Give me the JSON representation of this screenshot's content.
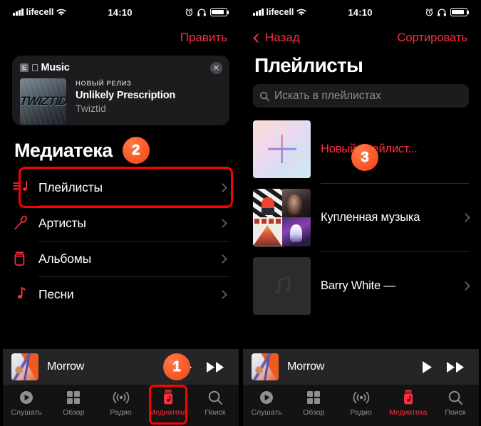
{
  "status_bar": {
    "carrier": "lifecell",
    "time": "14:10",
    "wifi_icon": "wifi-icon",
    "alarm_icon": "alarm-icon",
    "headphones_icon": "headphones-icon",
    "battery_icon": "battery-icon"
  },
  "colors": {
    "accent_red": "#ff2d3f",
    "highlight_red": "#ff0000",
    "badge_orange": "#fc5a2a",
    "background": "#000000",
    "card": "#1c1c1e",
    "inactive_gray": "#8e8e93"
  },
  "left_screen": {
    "nav": {
      "edit_label": "Править"
    },
    "promo": {
      "explicit_badge": "E",
      "brand": "Music",
      "apple_logo_icon": "apple-logo-icon",
      "close_icon": "close-icon",
      "kicker": "НОВЫЙ РЕЛИЗ",
      "title": "Unlikely Prescription",
      "artist": "Twiztid",
      "artwork_text": "TWIZTID"
    },
    "library": {
      "title": "Медиатека",
      "badge": "2",
      "items": [
        {
          "label": "Плейлисты",
          "icon": "playlist-icon",
          "highlighted": true
        },
        {
          "label": "Артисты",
          "icon": "microphone-icon",
          "highlighted": false
        },
        {
          "label": "Альбомы",
          "icon": "album-icon",
          "highlighted": false
        },
        {
          "label": "Песни",
          "icon": "music-note-icon",
          "highlighted": false
        }
      ]
    },
    "player": {
      "title": "Morrow",
      "play_icon": "play-icon",
      "next_icon": "fast-forward-icon",
      "badge": "1"
    },
    "tabs": [
      {
        "label": "Слушать",
        "icon": "listen-now-icon",
        "active": false
      },
      {
        "label": "Обзор",
        "icon": "browse-icon",
        "active": false
      },
      {
        "label": "Радио",
        "icon": "radio-icon",
        "active": false
      },
      {
        "label": "Медиатека",
        "icon": "library-icon",
        "active": true
      },
      {
        "label": "Поиск",
        "icon": "search-icon",
        "active": false
      }
    ]
  },
  "right_screen": {
    "nav": {
      "back_label": "Назад",
      "back_icon": "chevron-left-icon",
      "sort_label": "Сортировать"
    },
    "title": "Плейлисты",
    "search": {
      "placeholder": "Искать в плейлистах",
      "icon": "search-icon"
    },
    "badge": "3",
    "playlists": [
      {
        "name": "Новый плейлист...",
        "artwork": "new-playlist-gradient",
        "accent": true
      },
      {
        "name": "Купленная музыка",
        "artwork": "album-collage",
        "accent": false
      },
      {
        "name": "Barry White —",
        "artwork": "placeholder-note",
        "accent": false
      }
    ],
    "player": {
      "title": "Morrow",
      "play_icon": "play-icon",
      "next_icon": "fast-forward-icon"
    },
    "tabs": [
      {
        "label": "Слушать",
        "icon": "listen-now-icon",
        "active": false
      },
      {
        "label": "Обзор",
        "icon": "browse-icon",
        "active": false
      },
      {
        "label": "Радио",
        "icon": "radio-icon",
        "active": false
      },
      {
        "label": "Медиатека",
        "icon": "library-icon",
        "active": true
      },
      {
        "label": "Поиск",
        "icon": "search-icon",
        "active": false
      }
    ]
  }
}
